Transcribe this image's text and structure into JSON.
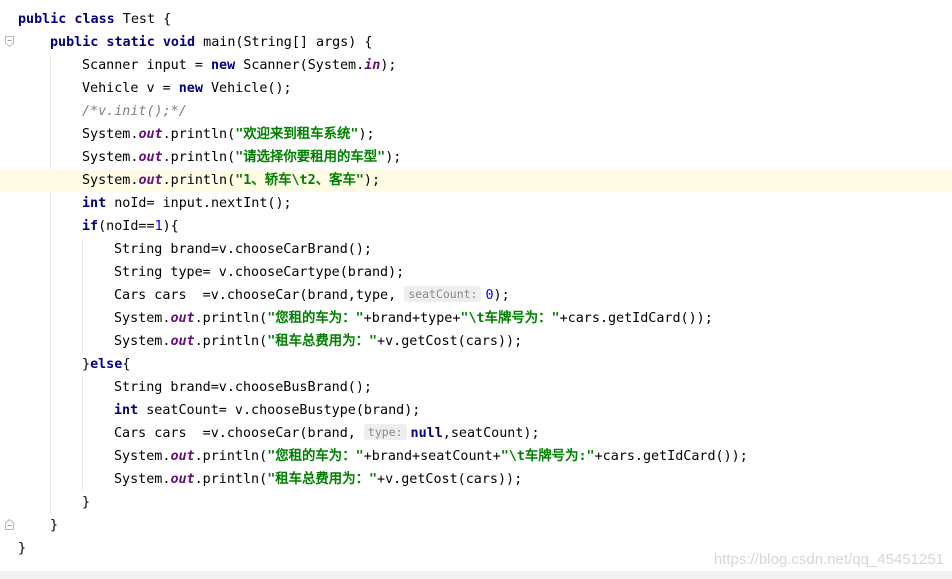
{
  "editor": {
    "language": "Java",
    "current_line_index": 7,
    "lines": [
      [
        {
          "t": "public class",
          "c": "kw"
        },
        {
          "t": " Test {"
        }
      ],
      [
        {
          "t": "public static void",
          "c": "kw"
        },
        {
          "t": " main(String[] args) {"
        }
      ],
      [
        {
          "t": "Scanner input = "
        },
        {
          "t": "new",
          "c": "kw"
        },
        {
          "t": " Scanner(System."
        },
        {
          "t": "in",
          "c": "fld"
        },
        {
          "t": ");"
        }
      ],
      [
        {
          "t": "Vehicle v = "
        },
        {
          "t": "new",
          "c": "kw"
        },
        {
          "t": " Vehicle();"
        }
      ],
      [
        {
          "t": "/*v.init();*/",
          "c": "cmt"
        }
      ],
      [
        {
          "t": "System."
        },
        {
          "t": "out",
          "c": "fld"
        },
        {
          "t": ".println("
        },
        {
          "t": "\"欢迎来到租车系统\"",
          "c": "str"
        },
        {
          "t": ");"
        }
      ],
      [
        {
          "t": "System."
        },
        {
          "t": "out",
          "c": "fld"
        },
        {
          "t": ".println("
        },
        {
          "t": "\"请选择你要租用的车型\"",
          "c": "str"
        },
        {
          "t": ");"
        }
      ],
      [
        {
          "t": "System."
        },
        {
          "t": "out",
          "c": "fld"
        },
        {
          "t": ".println("
        },
        {
          "t": "\"1、轿车\\t2、客车\"",
          "c": "str"
        },
        {
          "t": ");"
        }
      ],
      [
        {
          "t": "int",
          "c": "kw"
        },
        {
          "t": " noId= input.nextInt();"
        }
      ],
      [
        {
          "t": "if",
          "c": "kw"
        },
        {
          "t": "(noId=="
        },
        {
          "t": "1",
          "c": "num"
        },
        {
          "t": "){"
        }
      ],
      [
        {
          "t": "String brand=v.chooseCarBrand();"
        }
      ],
      [
        {
          "t": "String type= v.chooseCartype(brand);"
        }
      ],
      [
        {
          "t": "Cars cars  =v.chooseCar(brand,type, "
        },
        {
          "t": "seatCount:",
          "c": "hint"
        },
        {
          "t": "0",
          "c": "num"
        },
        {
          "t": ");"
        }
      ],
      [
        {
          "t": "System."
        },
        {
          "t": "out",
          "c": "fld"
        },
        {
          "t": ".println("
        },
        {
          "t": "\"您租的车为：\"",
          "c": "str"
        },
        {
          "t": "+brand+type+"
        },
        {
          "t": "\"\\t车牌号为：\"",
          "c": "str"
        },
        {
          "t": "+cars.getIdCard());"
        }
      ],
      [
        {
          "t": "System."
        },
        {
          "t": "out",
          "c": "fld"
        },
        {
          "t": ".println("
        },
        {
          "t": "\"租车总费用为：\"",
          "c": "str"
        },
        {
          "t": "+v.getCost(cars));"
        }
      ],
      [
        {
          "t": "}"
        },
        {
          "t": "else",
          "c": "kw"
        },
        {
          "t": "{"
        }
      ],
      [
        {
          "t": "String brand=v.chooseBusBrand();"
        }
      ],
      [
        {
          "t": "int",
          "c": "kw"
        },
        {
          "t": " seatCount= v.chooseBustype(brand);"
        }
      ],
      [
        {
          "t": "Cars cars  =v.chooseCar(brand, "
        },
        {
          "t": "type:",
          "c": "hint"
        },
        {
          "t": "null",
          "c": "kw"
        },
        {
          "t": ",seatCount);"
        }
      ],
      [
        {
          "t": "System."
        },
        {
          "t": "out",
          "c": "fld"
        },
        {
          "t": ".println("
        },
        {
          "t": "\"您租的车为：\"",
          "c": "str"
        },
        {
          "t": "+brand+seatCount+"
        },
        {
          "t": "\"\\t车牌号为:\"",
          "c": "str"
        },
        {
          "t": "+cars.getIdCard());"
        }
      ],
      [
        {
          "t": "System."
        },
        {
          "t": "out",
          "c": "fld"
        },
        {
          "t": ".println("
        },
        {
          "t": "\"租车总费用为：\"",
          "c": "str"
        },
        {
          "t": "+v.getCost(cars));"
        }
      ],
      [
        {
          "t": "}"
        }
      ],
      [
        {
          "t": "}"
        }
      ],
      [
        {
          "t": "}"
        }
      ]
    ]
  },
  "colors": {
    "keyword": "#000080",
    "string": "#008000",
    "static_field": "#660e7a",
    "number": "#0000ff",
    "comment": "#808080",
    "current_line_bg": "#fefce4",
    "inlay_hint_bg": "#eeeeee"
  },
  "watermark": "https://blog.csdn.net/qq_45451251"
}
